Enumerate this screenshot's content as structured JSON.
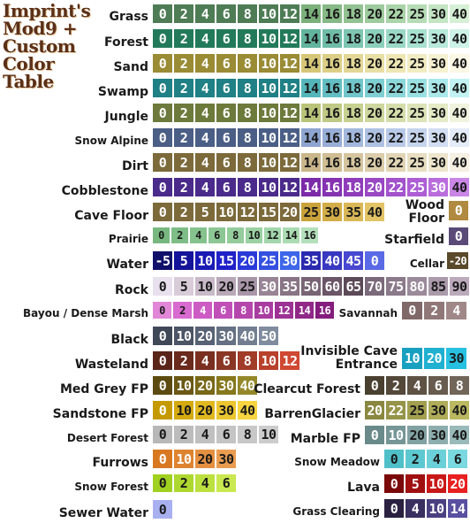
{
  "title": "Imprint's Mod9 + Custom Color Table",
  "tables": [
    {
      "name": "Grass",
      "values": [
        "0",
        "2",
        "4",
        "6",
        "8",
        "10",
        "12",
        "14",
        "16",
        "18",
        "20",
        "22",
        "25",
        "30",
        "40"
      ],
      "colors": [
        "#4e7c55",
        "#4e7c55",
        "#4e7c55",
        "#4e7c55",
        "#4e7c55",
        "#4e7c55",
        "#4e7c55",
        "#7bb07b",
        "#86b986",
        "#92c292",
        "#9ecb9e",
        "#aad4aa",
        "#b6dcb6",
        "#c3e5c3",
        "#d6f0d6"
      ]
    },
    {
      "name": "Forest",
      "values": [
        "0",
        "2",
        "4",
        "6",
        "8",
        "10",
        "12",
        "14",
        "16",
        "18",
        "20",
        "22",
        "25",
        "30",
        "40"
      ],
      "colors": [
        "#237a5a",
        "#237a5a",
        "#237a5a",
        "#237a5a",
        "#237a5a",
        "#237a5a",
        "#237a5a",
        "#62b49d",
        "#70bda7",
        "#7ec6b1",
        "#8ccfbb",
        "#9ad8c5",
        "#a8e1cf",
        "#b8e9da",
        "#cef2e7"
      ]
    },
    {
      "name": "Sand",
      "values": [
        "0",
        "2",
        "4",
        "6",
        "8",
        "10",
        "12",
        "14",
        "16",
        "18",
        "20",
        "22",
        "25",
        "30",
        "40"
      ],
      "colors": [
        "#9a8b35",
        "#9a8b35",
        "#9a8b35",
        "#9a8b35",
        "#9a8b35",
        "#9a8b35",
        "#9a8b35",
        "#d6c778",
        "#dccf87",
        "#e2d796",
        "#e8dfa5",
        "#eee6b4",
        "#f2ecc3",
        "#f6f1d1",
        "#fbf8e6"
      ]
    },
    {
      "name": "Swamp",
      "values": [
        "0",
        "2",
        "4",
        "6",
        "8",
        "10",
        "12",
        "14",
        "16",
        "18",
        "20",
        "22",
        "25",
        "30",
        "40"
      ],
      "colors": [
        "#1f8085",
        "#1f8085",
        "#1f8085",
        "#1f8085",
        "#1f8085",
        "#1f8085",
        "#1f8085",
        "#55b6ba",
        "#62bec2",
        "#70c6ca",
        "#7ecfd2",
        "#8cd7da",
        "#9ae0e2",
        "#aae8ea",
        "#c2f2f3"
      ]
    },
    {
      "name": "Jungle",
      "values": [
        "0",
        "2",
        "4",
        "6",
        "8",
        "10",
        "12",
        "14",
        "16",
        "18",
        "20",
        "22",
        "25",
        "30",
        "40"
      ],
      "colors": [
        "#6c7a3b",
        "#6c7a3b",
        "#6c7a3b",
        "#6c7a3b",
        "#6c7a3b",
        "#6c7a3b",
        "#6c7a3b",
        "#b9c47a",
        "#c0ca86",
        "#c7d192",
        "#ced79e",
        "#d5deab",
        "#dce4b8",
        "#e5ebc7",
        "#f0f4de"
      ]
    },
    {
      "name": "Snow Alpine",
      "values": [
        "0",
        "2",
        "4",
        "6",
        "8",
        "10",
        "12",
        "14",
        "16",
        "18",
        "20",
        "22",
        "25",
        "30",
        "40"
      ],
      "colors": [
        "#4b5f86",
        "#4b5f86",
        "#4b5f86",
        "#4b5f86",
        "#4b5f86",
        "#4b5f86",
        "#4b5f86",
        "#8ea5d0",
        "#98aed6",
        "#a3b8dc",
        "#aec1e2",
        "#b9cae8",
        "#c5d4ed",
        "#d1ddf2",
        "#e4ebf9"
      ]
    },
    {
      "name": "Dirt",
      "values": [
        "0",
        "2",
        "4",
        "6",
        "8",
        "10",
        "12",
        "14",
        "16",
        "18",
        "20",
        "22",
        "25",
        "30",
        "40"
      ],
      "colors": [
        "#7c6a3b",
        "#7c6a3b",
        "#7c6a3b",
        "#7c6a3b",
        "#7c6a3b",
        "#7c6a3b",
        "#7c6a3b",
        "#c9b68a",
        "#cfbd94",
        "#d5c59f",
        "#dbcdaa",
        "#e1d5b5",
        "#e7dec1",
        "#ede6cd",
        "#f5f0e2"
      ]
    },
    {
      "name": "Cobblestone",
      "values": [
        "0",
        "2",
        "4",
        "6",
        "8",
        "10",
        "12",
        "14",
        "16",
        "18",
        "20",
        "22",
        "25",
        "30",
        "40"
      ],
      "colors": [
        "#4a2a8a",
        "#4a2a8a",
        "#4a2a8a",
        "#4a2a8a",
        "#4a2a8a",
        "#4a2a8a",
        "#4a2a8a",
        "#7b2aa8",
        "#8533b1",
        "#8f3dba",
        "#9947c3",
        "#a352cc",
        "#ad5ed4",
        "#b96ddc",
        "#c986e6"
      ]
    },
    {
      "name": "Cave Floor",
      "values": [
        "0",
        "2",
        "5",
        "10",
        "12",
        "15",
        "20",
        "25",
        "30",
        "35",
        "40"
      ],
      "colors": [
        "#7c6a3b",
        "#7c6a3b",
        "#7c6a3b",
        "#7c6a3b",
        "#7c6a3b",
        "#7c6a3b",
        "#7c6a3b",
        "#c9a23a",
        "#d2ad48",
        "#dab857",
        "#e2c366"
      ]
    },
    {
      "name": "Prairie",
      "values": [
        "0",
        "2",
        "4",
        "6",
        "8",
        "10",
        "12",
        "14",
        "16"
      ],
      "colors": [
        "#78b880",
        "#7fbd87",
        "#86c28e",
        "#8dc795",
        "#94cc9c",
        "#9bd1a3",
        "#a3d6ab",
        "#abdbb3",
        "#b4e0bb"
      ]
    },
    {
      "name": "Water",
      "values": [
        "-5",
        "5",
        "10",
        "15",
        "20",
        "25",
        "30",
        "35",
        "40",
        "45",
        "0"
      ],
      "colors": [
        "#10106a",
        "#14149a",
        "#1a1ab4",
        "#2020c8",
        "#2a3ad8",
        "#3450e0",
        "#3e66e8",
        "#2a2ab0",
        "#3838c0",
        "#4848d0",
        "#5a6ae6"
      ]
    },
    {
      "name": "Rock",
      "values": [
        "0",
        "5",
        "10",
        "20",
        "25",
        "30",
        "35",
        "50",
        "60",
        "65",
        "70",
        "75",
        "80",
        "85",
        "90"
      ],
      "colors": [
        "#e8e0ec",
        "#d8ccd8",
        "#c8bac8",
        "#b8a8b8",
        "#a896a8",
        "#988494",
        "#887484",
        "#786474",
        "#6a5666",
        "#5c4a58",
        "#7a6a7a",
        "#8a7a8a",
        "#9a8a9a",
        "#aa9aaa",
        "#bbaabb"
      ]
    },
    {
      "name": "Bayou / Dense Marsh",
      "values": [
        "0",
        "2",
        "4",
        "6",
        "8",
        "10",
        "12",
        "14",
        "16"
      ],
      "colors": [
        "#e287d8",
        "#d86ad0",
        "#cc5cc4",
        "#c050b8",
        "#b446ac",
        "#a83ca0",
        "#9c3294",
        "#902888",
        "#841e7c"
      ]
    },
    {
      "name": "Black",
      "values": [
        "0",
        "10",
        "20",
        "30",
        "40",
        "50"
      ],
      "colors": [
        "#404858",
        "#4c5466",
        "#586274",
        "#657082",
        "#727e90",
        "#808c9e"
      ]
    },
    {
      "name": "Wasteland",
      "values": [
        "0",
        "2",
        "4",
        "6",
        "8",
        "10",
        "12"
      ],
      "colors": [
        "#5a2418",
        "#6a2a1c",
        "#7a3020",
        "#8a3624",
        "#a03c28",
        "#b8402c",
        "#d04832"
      ]
    },
    {
      "name": "Med Grey FP",
      "values": [
        "0",
        "10",
        "20",
        "30",
        "40"
      ],
      "colors": [
        "#5c4a10",
        "#6a5814",
        "#786818",
        "#86781c",
        "#94882a"
      ]
    },
    {
      "name": "Sandstone FP",
      "values": [
        "0",
        "10",
        "20",
        "30",
        "40"
      ],
      "colors": [
        "#c49a00",
        "#d4aa10",
        "#e0b820",
        "#ecc630",
        "#f6d440"
      ]
    },
    {
      "name": "Desert Forest",
      "values": [
        "0",
        "2",
        "4",
        "6",
        "8",
        "10"
      ],
      "colors": [
        "#b8b8b8",
        "#bcbcbc",
        "#c0c0c0",
        "#c4c4c4",
        "#c8c8c8",
        "#cccccc"
      ]
    },
    {
      "name": "Furrows",
      "values": [
        "0",
        "10",
        "20",
        "30"
      ],
      "colors": [
        "#d87820",
        "#de8430",
        "#e49040",
        "#ea9c50"
      ]
    },
    {
      "name": "Snow Forest",
      "values": [
        "0",
        "2",
        "4",
        "6"
      ],
      "colors": [
        "#a0d020",
        "#aed830",
        "#bce040",
        "#cae850"
      ]
    },
    {
      "name": "Sewer Water",
      "values": [
        "0"
      ],
      "colors": [
        "#a8b0f0"
      ]
    },
    {
      "name": "Wood Floor",
      "values": [
        "0"
      ],
      "colors": [
        "#b08a40"
      ]
    },
    {
      "name": "Starfield",
      "values": [
        "0"
      ],
      "colors": [
        "#5a4a78"
      ]
    },
    {
      "name": "Cellar",
      "values": [
        "-20"
      ],
      "colors": [
        "#5a4a2a"
      ]
    },
    {
      "name": "Savannah",
      "values": [
        "0",
        "2",
        "4"
      ],
      "colors": [
        "#806868",
        "#907878",
        "#a08888"
      ]
    },
    {
      "name": "Invisible Cave Entrance",
      "values": [
        "10",
        "20",
        "30"
      ],
      "colors": [
        "#18a0c0",
        "#20b0d0",
        "#28c0e0"
      ]
    },
    {
      "name": "Clearcut Forest",
      "values": [
        "0",
        "2",
        "4",
        "6",
        "8"
      ],
      "colors": [
        "#4a4030",
        "#54483a",
        "#5e5244",
        "#685c4e",
        "#726658"
      ]
    },
    {
      "name": "BarrenGlacier",
      "values": [
        "20",
        "22",
        "25",
        "30",
        "40"
      ],
      "colors": [
        "#8a8840",
        "#969448",
        "#a2a050",
        "#aeac58",
        "#bab860"
      ]
    },
    {
      "name": "Marble FP",
      "values": [
        "0",
        "10",
        "20",
        "30",
        "40"
      ],
      "colors": [
        "#6a8a8a",
        "#769696",
        "#82a2a2",
        "#8eaeae",
        "#9ababa"
      ]
    },
    {
      "name": "Snow Meadow",
      "values": [
        "0",
        "2",
        "4",
        "6"
      ],
      "colors": [
        "#50c0c8",
        "#5ec8d0",
        "#6cd0d8",
        "#7ad8e0"
      ]
    },
    {
      "name": "Lava",
      "values": [
        "0",
        "5",
        "10",
        "20"
      ],
      "colors": [
        "#7a0808",
        "#a01010",
        "#c81818",
        "#e82020"
      ]
    },
    {
      "name": "Grass Clearing",
      "values": [
        "0",
        "4",
        "10",
        "14"
      ],
      "colors": [
        "#2a2040",
        "#3a3060",
        "#4a4080",
        "#5a50a0"
      ]
    }
  ]
}
